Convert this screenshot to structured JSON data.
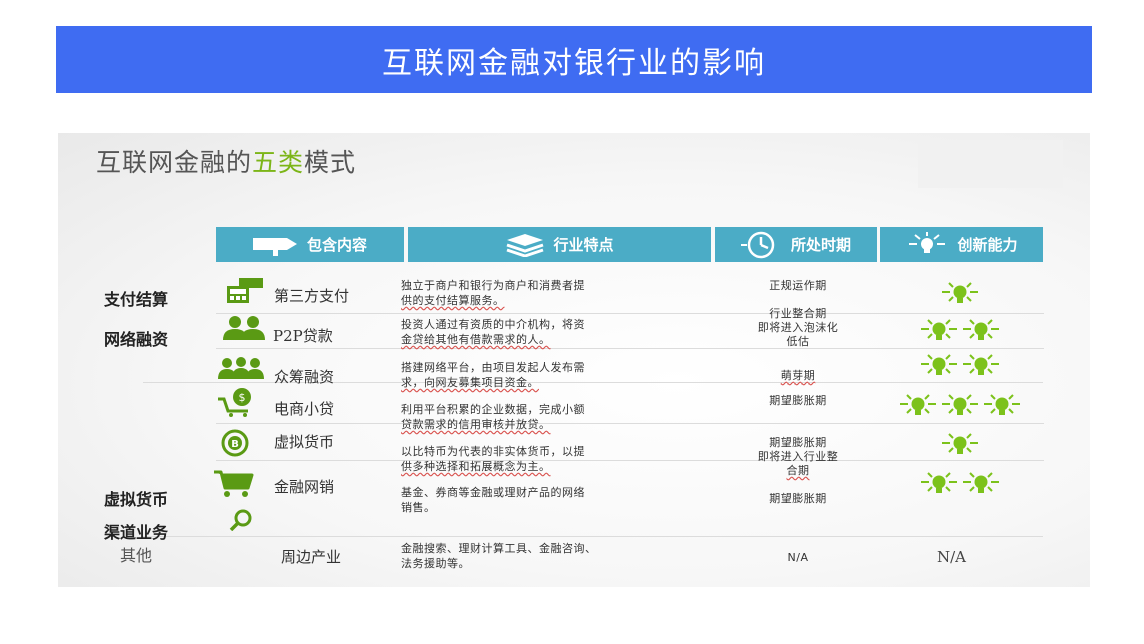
{
  "banner": {
    "title": "互联网金融对银行业的影响"
  },
  "slide": {
    "title_prefix": "互联网金融的",
    "title_accent": "五类",
    "title_suffix": "模式"
  },
  "headers": {
    "content": "包含内容",
    "features": "行业特点",
    "period": "所处时期",
    "innovation": "创新能力"
  },
  "categories": [
    "支付结算",
    "网络融资",
    "虚拟货币",
    "渠道业务",
    "其他"
  ],
  "items": [
    {
      "label": "第三方支付",
      "icon": "pos-terminal-icon"
    },
    {
      "label": "P2P贷款",
      "icon": "people-icon"
    },
    {
      "label": "众筹融资",
      "icon": "crowd-icon"
    },
    {
      "label": "电商小贷",
      "icon": "cart-coin-icon"
    },
    {
      "label": "虚拟货币",
      "icon": "bitcoin-icon"
    },
    {
      "label": "金融网销",
      "icon": "shopping-cart-icon"
    },
    {
      "label": "",
      "icon": "magnifier-icon"
    },
    {
      "label": "周边产业",
      "icon": ""
    }
  ],
  "features": {
    "f1_a": "独立于商户和银行为商户和消费者提",
    "f1_b": "供的支付结算服务。",
    "f2_a": "投资人通过有资质的中介机构，将资",
    "f2_b": "金贷给其他有借款需求的人。",
    "f3_a": "搭建网络平台，由项目发起人发布需",
    "f3_b": "求，向网友募集项目资金。",
    "f4_a": "利用平台积累的企业数据，完成小额",
    "f4_b": "贷款需求的信用审核并放贷。",
    "f5_a": "以比特币为代表的非实体货币，以提",
    "f5_b": "供多种选择和拓展概念为主。",
    "f6_a": "基金、券商等金融或理财产品的网络",
    "f6_b": "销售。",
    "f7_a": "金融搜索、理财计算工具、金融咨询、",
    "f7_b": "法务援助等。"
  },
  "periods": {
    "p1": "正规运作期",
    "p2_a": "行业整合期",
    "p2_b": "即将进入泡沫化",
    "p2_c": "低估",
    "p3": "萌芽期",
    "p4": "期望膨胀期",
    "p5_a": "期望膨胀期",
    "p5_b": "即将进入行业整",
    "p5_c": "合期",
    "p6": "期望膨胀期",
    "p7": "N/A"
  },
  "innovation": {
    "levels": [
      1,
      2,
      2,
      3,
      1,
      2
    ],
    "other": "N/A"
  },
  "colors": {
    "banner": "#3f6cf2",
    "header": "#4bacc6",
    "icon_green": "#5a9a14",
    "bulb_green": "#7cc21b",
    "accent": "#7cb518"
  }
}
